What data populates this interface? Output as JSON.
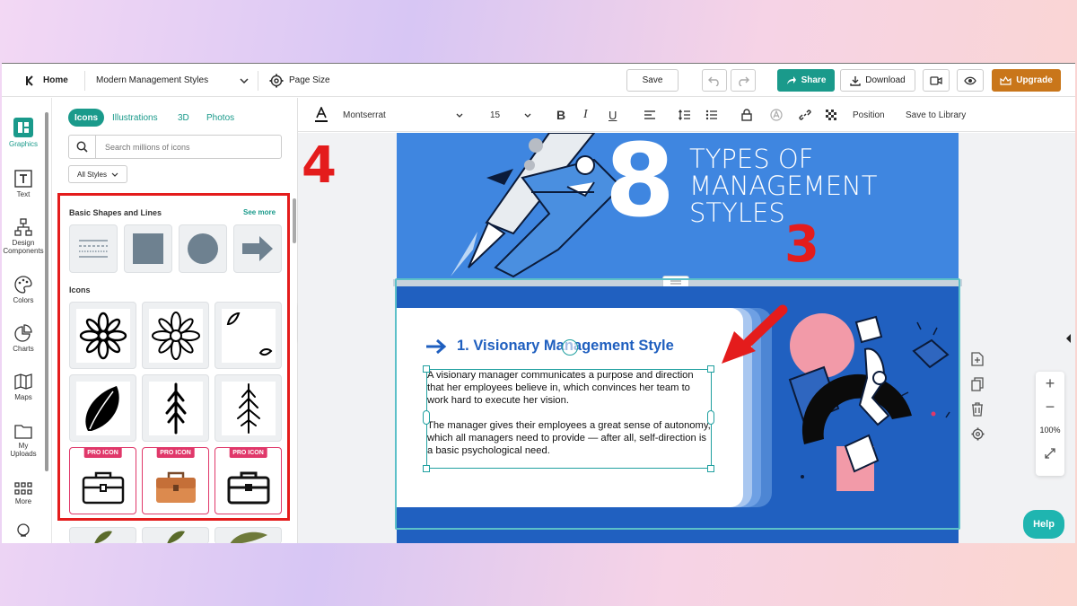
{
  "topbar": {
    "home_label": "Home",
    "doc_title": "Modern Management Styles",
    "page_size_label": "Page Size",
    "save_label": "Save",
    "share_label": "Share",
    "download_label": "Download",
    "upgrade_label": "Upgrade"
  },
  "toolbar": {
    "font_family": "Montserrat",
    "font_size": "15",
    "position_label": "Position",
    "save_to_library_label": "Save to Library"
  },
  "rail": {
    "items": [
      {
        "label": "Graphics",
        "icon": "graphics-icon"
      },
      {
        "label": "Text",
        "icon": "text-icon"
      },
      {
        "label": "Design Components",
        "icon": "components-icon"
      },
      {
        "label": "Colors",
        "icon": "palette-icon"
      },
      {
        "label": "Charts",
        "icon": "chart-icon"
      },
      {
        "label": "Maps",
        "icon": "map-icon"
      },
      {
        "label": "My Uploads",
        "icon": "folder-icon"
      },
      {
        "label": "More",
        "icon": "grid-icon"
      }
    ]
  },
  "panel": {
    "tabs": [
      "Icons",
      "Illustrations",
      "3D",
      "Photos"
    ],
    "search_placeholder": "Search millions of icons",
    "style_filter": "All Styles",
    "basic_shapes_title": "Basic Shapes and Lines",
    "see_more_label": "See more",
    "icons_title": "Icons",
    "pro_badge": "PRO ICON"
  },
  "canvas": {
    "big_number": "8",
    "title_lines": [
      "TYPES OF",
      "MANAGEMENT",
      "STYLES"
    ],
    "section_heading": "1. Visionary Management Style",
    "paragraph_1": "A visionary manager communicates a purpose and direction that her employees believe in, which convinces her team to work hard to execute her vision.",
    "paragraph_2": "The manager gives their employees a great sense of autonomy, which all managers need to provide — after all, self-direction is a basic psychological need."
  },
  "zoom": {
    "level": "100%"
  },
  "help_label": "Help",
  "annotations": {
    "step_a": "4",
    "step_b": "3"
  },
  "colors": {
    "accent": "#1a9a8b",
    "upgrade": "#c9761a",
    "annotation": "#e41c1c",
    "page_blue": "#3f86e0",
    "page_navy": "#2060c0"
  }
}
